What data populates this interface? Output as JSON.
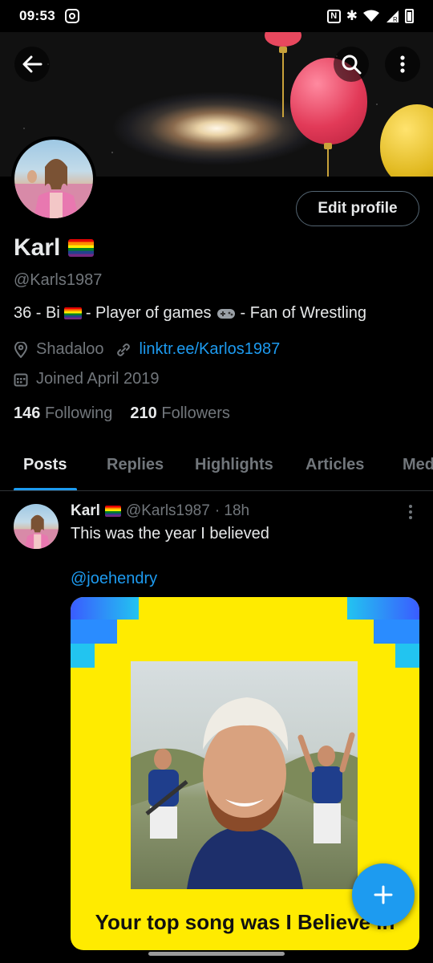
{
  "status_bar": {
    "time": "09:53",
    "network": "R"
  },
  "profile": {
    "name": "Karl",
    "handle": "@Karls1987",
    "bio_parts": {
      "prefix": "36 - Bi",
      "middle": "- Player of games",
      "suffix": "- Fan of Wrestling"
    },
    "location": "Shadaloo",
    "link": "linktr.ee/Karlos1987",
    "joined": "Joined April 2019",
    "following_count": "146",
    "following_label": "Following",
    "followers_count": "210",
    "followers_label": "Followers",
    "edit_label": "Edit profile"
  },
  "tabs": [
    {
      "label": "Posts",
      "active": true
    },
    {
      "label": "Replies"
    },
    {
      "label": "Highlights"
    },
    {
      "label": "Articles"
    },
    {
      "label": "Media"
    }
  ],
  "post": {
    "author": "Karl",
    "handle": "@Karls1987",
    "time": "· 18h",
    "text": "This was the year I believed",
    "mention": "@joehendry",
    "media_caption": "Your top song was I Believe in"
  },
  "colors": {
    "accent": "#1d9bf0",
    "background": "#000000",
    "muted": "#71767b",
    "card_yellow": "#ffeb00"
  },
  "icons": {
    "back": "arrow-left-icon",
    "search": "search-icon",
    "more": "more-vertical-icon",
    "location": "location-pin-icon",
    "link": "link-icon",
    "calendar": "calendar-icon",
    "compose": "plus-icon"
  }
}
